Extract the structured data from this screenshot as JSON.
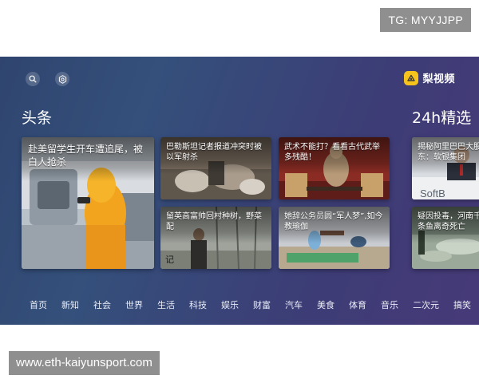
{
  "watermarks": {
    "telegram": "TG: MYYJJPP",
    "site": "www.eth-kaiyunsport.com"
  },
  "header": {
    "search_icon": "search-icon",
    "settings_icon": "settings-icon",
    "brand_logo_icon": "pear-logo-icon",
    "brand_name": "梨视频"
  },
  "sections": {
    "headline": "头条",
    "picks": "24h精选"
  },
  "cards": {
    "big": "赴美留学生开车遭追尾，被白人抢杀",
    "c1": "巴勒斯坦记者报道冲突时被以军射杀",
    "c2": "武术不能打？看看古代武举多残酷！",
    "c3": "留英高富帅回村种树，野菜配",
    "c4": "她辞公务员圆“军人梦”,如今教瑜伽",
    "c5": "揭秘阿里巴巴大股东：软银集团",
    "c6": "疑因投毒，河南千条鱼离奇死亡"
  },
  "nav": [
    "首页",
    "新知",
    "社会",
    "世界",
    "生活",
    "科技",
    "娱乐",
    "财富",
    "汽车",
    "美食",
    "体育",
    "音乐",
    "二次元",
    "搞笑"
  ],
  "colors": {
    "accent": "#f6c21c",
    "screen_bg_start": "#2f456f",
    "screen_bg_end": "#473a78"
  }
}
